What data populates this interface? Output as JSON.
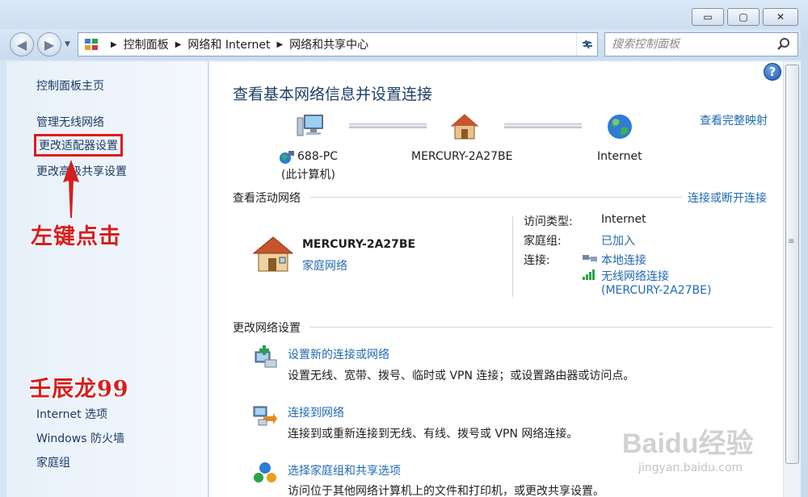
{
  "window": {
    "minimize_glyph": "▭",
    "maximize_glyph": "▢",
    "close_glyph": "✕"
  },
  "nav": {
    "breadcrumb": [
      "控制面板",
      "网络和 Internet",
      "网络和共享中心"
    ],
    "search_placeholder": "搜索控制面板"
  },
  "sidebar": {
    "home": "控制面板主页",
    "items": [
      "管理无线网络",
      "更改适配器设置",
      "更改高级共享设置"
    ],
    "see_also": [
      "Internet 选项",
      "Windows 防火墙",
      "家庭组"
    ]
  },
  "annotations": {
    "click_hint": "左键点击",
    "author": "壬辰龙99"
  },
  "main": {
    "title": "查看基本网络信息并设置连接",
    "full_map_link": "查看完整映射",
    "map": {
      "pc_name": "688-PC",
      "pc_sub": "(此计算机)",
      "router_name": "MERCURY-2A27BE",
      "internet_name": "Internet"
    },
    "active": {
      "heading": "查看活动网络",
      "connect_link": "连接或断开连接",
      "network_name": "MERCURY-2A27BE",
      "network_type": "家庭网络",
      "access_label": "访问类型:",
      "access_value": "Internet",
      "homegroup_label": "家庭组:",
      "homegroup_value": "已加入",
      "conn_label": "连接:",
      "conn_local": "本地连接",
      "conn_wireless": "无线网络连接",
      "conn_wireless_ssid": "(MERCURY-2A27BE)"
    },
    "change": {
      "heading": "更改网络设置",
      "tasks": [
        {
          "title": "设置新的连接或网络",
          "desc": "设置无线、宽带、拨号、临时或 VPN 连接；或设置路由器或访问点。"
        },
        {
          "title": "连接到网络",
          "desc": "连接到或重新连接到无线、有线、拨号或 VPN 网络连接。"
        },
        {
          "title": "选择家庭组和共享选项",
          "desc": "访问位于其他网络计算机上的文件和打印机，或更改共享设置。"
        }
      ]
    }
  },
  "watermark": {
    "brand": "Baidu经验",
    "url": "jingyan.baidu.com"
  },
  "colors": {
    "link": "#1f6ab4",
    "annotation_red": "#d41f1f",
    "title_blue": "#1e3f66"
  }
}
